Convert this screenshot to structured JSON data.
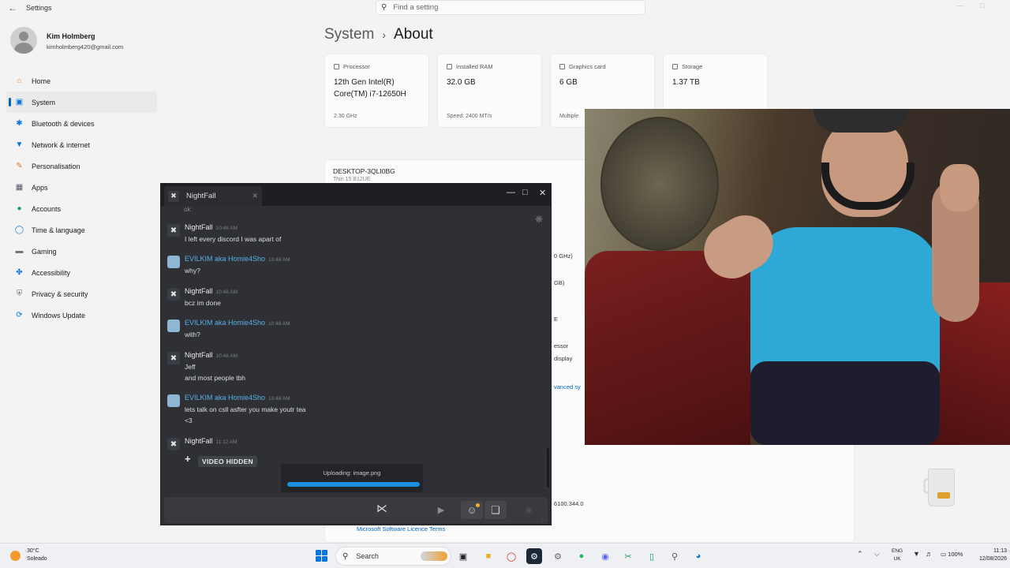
{
  "settings": {
    "app_title": "Settings",
    "search_placeholder": "Find a setting",
    "profile": {
      "name": "Kim Holmberg",
      "email": "kimholmberg420@gmail.com"
    },
    "nav": [
      {
        "label": "Home",
        "icon": "home-icon"
      },
      {
        "label": "System",
        "icon": "monitor-icon",
        "active": true
      },
      {
        "label": "Bluetooth & devices",
        "icon": "bluetooth-icon"
      },
      {
        "label": "Network & internet",
        "icon": "wifi-icon"
      },
      {
        "label": "Personalisation",
        "icon": "brush-icon"
      },
      {
        "label": "Apps",
        "icon": "apps-icon"
      },
      {
        "label": "Accounts",
        "icon": "person-icon"
      },
      {
        "label": "Time & language",
        "icon": "globe-icon"
      },
      {
        "label": "Gaming",
        "icon": "gamepad-icon"
      },
      {
        "label": "Accessibility",
        "icon": "accessibility-icon"
      },
      {
        "label": "Privacy & security",
        "icon": "shield-icon"
      },
      {
        "label": "Windows Update",
        "icon": "update-icon"
      }
    ],
    "breadcrumb": {
      "parent": "System",
      "current": "About"
    },
    "cards": [
      {
        "label": "Processor",
        "value": "12th Gen Intel(R) Core(TM) i7-12650H",
        "sub": "2.30 GHz"
      },
      {
        "label": "Installed RAM",
        "value": "32.0 GB",
        "sub": "Speed: 2400 MT/s"
      },
      {
        "label": "Graphics card",
        "value": "6 GB",
        "sub": "Multiple"
      },
      {
        "label": "Storage",
        "value": "1.37 TB",
        "sub": ""
      }
    ],
    "device_name": "DESKTOP-3QLI0BG",
    "device_sub": "Thin 15 B12UE",
    "fragments": {
      "ghz": "0 GHz)",
      "gb": "GB)",
      "e": "E",
      "essor": "essor",
      "display": "display",
      "advanced": "vanced sy",
      "version": "6100.344.0",
      "licence": "Microsoft Software Licence Terms"
    }
  },
  "discord": {
    "tab_title": "NightFall",
    "ghost": "ok",
    "messages": [
      {
        "author": "NightFall",
        "time": "10:48 AM",
        "lines": [
          "I left every discord I was apart of"
        ],
        "type": "nf"
      },
      {
        "author": "EVILKIM aka Homie4Sho",
        "time": "10:48 AM",
        "lines": [
          "why?"
        ],
        "type": "ek"
      },
      {
        "author": "NightFall",
        "time": "10:48 AM",
        "lines": [
          "bcz im done"
        ],
        "type": "nf"
      },
      {
        "author": "EVILKIM aka Homie4Sho",
        "time": "10:48 AM",
        "lines": [
          "with?"
        ],
        "type": "ek"
      },
      {
        "author": "NightFall",
        "time": "10:48 AM",
        "lines": [
          "Jeff",
          "and most people tbh"
        ],
        "type": "nf"
      },
      {
        "author": "EVILKIM aka Homie4Sho",
        "time": "10:48 AM",
        "lines": [
          "lets talk on csll asfter you make youtr tea",
          "<3"
        ],
        "type": "ek"
      },
      {
        "author": "NightFall",
        "time": "11:12 AM",
        "lines": [],
        "type": "nf"
      }
    ],
    "video_hidden": "VIDEO HIDDEN",
    "upload_text": "Uploading: image.png",
    "upload_progress": 1.0
  },
  "taskbar": {
    "weather_temp": "30°C",
    "weather_desc": "Soleado",
    "search_label": "Search",
    "lang_top": "ENG",
    "lang_bottom": "UK",
    "battery": "100%",
    "time": "11:13",
    "date": "12/08/2026",
    "apps": [
      "file-explorer-icon",
      "folder-icon",
      "opera-icon",
      "steam-icon",
      "settings-icon",
      "spotify-icon",
      "discord-icon",
      "snipping-icon",
      "phone-icon",
      "drone-icon",
      "edge-icon"
    ]
  },
  "colors": {
    "accent": "#0067c0",
    "discord_bg": "#2e3035",
    "discord_link": "#5ab0e6",
    "upload": "#1a8fe0"
  }
}
